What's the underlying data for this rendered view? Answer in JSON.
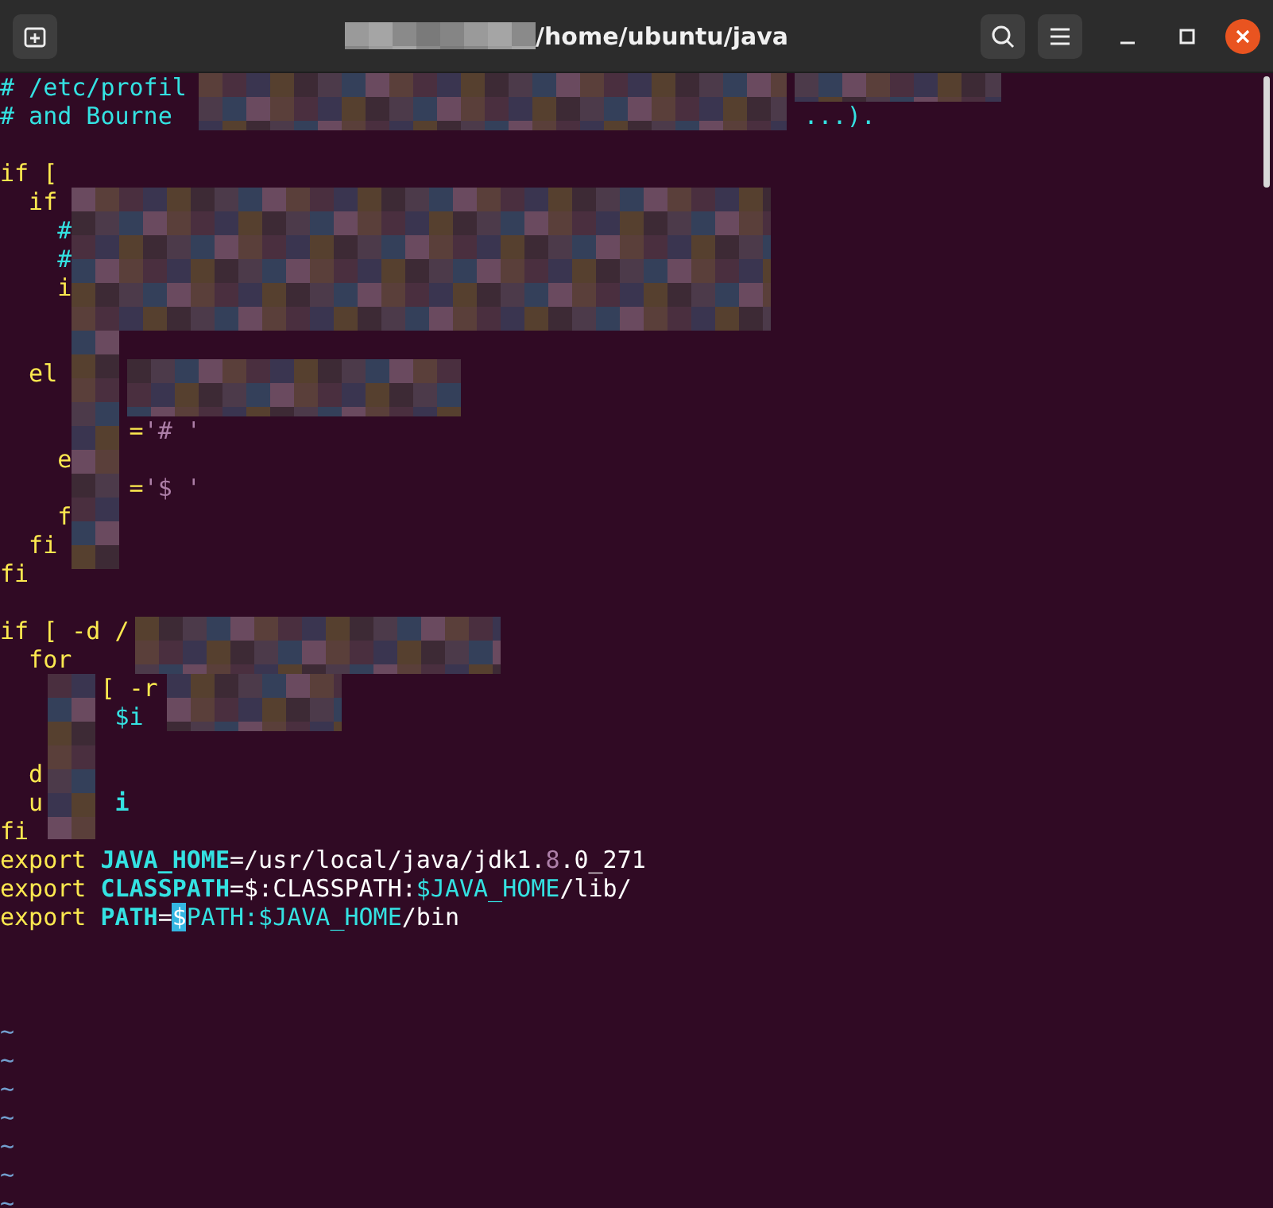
{
  "window": {
    "title": "/home/ubuntu/java"
  },
  "editor": {
    "lines": [
      [
        {
          "kind": "comment",
          "text": "# /etc/profil"
        }
      ],
      [
        {
          "kind": "comment",
          "text": "# and Bourne"
        },
        {
          "kind": "comment",
          "text": "                                            ...)."
        }
      ],
      {
        "kind": "blank"
      },
      [
        {
          "kind": "keyword",
          "text": "if ["
        }
      ],
      [
        {
          "kind": "keyword",
          "text": "  if"
        }
      ],
      [
        {
          "kind": "comment",
          "text": "    #"
        }
      ],
      [
        {
          "kind": "comment",
          "text": "    #"
        }
      ],
      [
        {
          "kind": "keyword",
          "text": "    i"
        }
      ],
      {
        "kind": "blank"
      },
      {
        "kind": "blank"
      },
      [
        {
          "kind": "keyword",
          "text": "  el"
        }
      ],
      {
        "kind": "blank"
      },
      [
        {
          "kind": "keyword",
          "text": "         ="
        },
        {
          "kind": "string",
          "text": "'# '"
        }
      ],
      [
        {
          "kind": "keyword",
          "text": "    e"
        }
      ],
      [
        {
          "kind": "keyword",
          "text": "         ="
        },
        {
          "kind": "string",
          "text": "'$ '"
        }
      ],
      [
        {
          "kind": "keyword",
          "text": "    f"
        }
      ],
      [
        {
          "kind": "keyword",
          "text": "  fi"
        }
      ],
      [
        {
          "kind": "keyword",
          "text": "fi"
        }
      ],
      {
        "kind": "blank"
      },
      [
        {
          "kind": "keyword",
          "text": "if [ -d /"
        }
      ],
      [
        {
          "kind": "keyword",
          "text": "  for"
        }
      ],
      [
        {
          "kind": "keyword",
          "text": "       [ -r"
        }
      ],
      [
        {
          "kind": "var",
          "text": "        $i"
        }
      ],
      {
        "kind": "blank"
      },
      [
        {
          "kind": "keyword",
          "text": "  d"
        }
      ],
      [
        {
          "kind": "keyword",
          "text": "  u"
        },
        {
          "kind": "ident",
          "text": "     i"
        }
      ],
      [
        {
          "kind": "keyword",
          "text": "fi"
        }
      ],
      [
        {
          "kind": "keyword",
          "text": "export"
        },
        {
          "kind": "ident",
          "text": " JAVA_HOME"
        },
        {
          "kind": "plain",
          "text": "=/usr/local/java/jdk1."
        },
        {
          "kind": "number",
          "text": "8"
        },
        {
          "kind": "plain",
          "text": ".0_271"
        }
      ],
      [
        {
          "kind": "keyword",
          "text": "export"
        },
        {
          "kind": "ident",
          "text": " CLASSPATH"
        },
        {
          "kind": "plain",
          "text": "=$:CLASSPATH:"
        },
        {
          "kind": "var",
          "text": "$JAVA_HOME"
        },
        {
          "kind": "plain",
          "text": "/lib/"
        }
      ],
      [
        {
          "kind": "keyword",
          "text": "export"
        },
        {
          "kind": "ident",
          "text": " PATH"
        },
        {
          "kind": "plain",
          "text": "="
        },
        {
          "kind": "cursor",
          "text": "$"
        },
        {
          "kind": "var",
          "text": "PATH:$JAVA_HOME"
        },
        {
          "kind": "plain",
          "text": "/bin"
        }
      ],
      {
        "kind": "blank"
      },
      {
        "kind": "blank"
      },
      {
        "kind": "blank"
      },
      [
        {
          "kind": "tilde",
          "text": "~"
        }
      ],
      [
        {
          "kind": "tilde",
          "text": "~"
        }
      ],
      [
        {
          "kind": "tilde",
          "text": "~"
        }
      ],
      [
        {
          "kind": "tilde",
          "text": "~"
        }
      ],
      [
        {
          "kind": "tilde",
          "text": "~"
        }
      ],
      [
        {
          "kind": "tilde",
          "text": "~"
        }
      ],
      [
        {
          "kind": "tilde",
          "text": "~"
        }
      ]
    ]
  }
}
